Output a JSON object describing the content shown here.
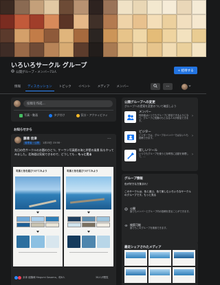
{
  "cover": {
    "colors": [
      "#3b2a22",
      "#8a6a52",
      "#c4a07a",
      "#e2c9a3",
      "#6d4b36",
      "#b89272",
      "#2e2320",
      "#9a7358",
      "#f0e2c6",
      "#e9d7b5",
      "#f3e8cf",
      "#f6ecd8",
      "#ead7b8",
      "#f5ebd6",
      "#7a2c20",
      "#c25a3a",
      "#a03e2a",
      "#d88a5a",
      "#5a3426",
      "#e6b888",
      "#403028",
      "#b37a50",
      "#efd3a8",
      "#e8c18e",
      "#f4deb8",
      "#ecd09e",
      "#f2dfbf",
      "#f6e8cf",
      "#5b3a2c",
      "#d4a06a",
      "#c27c48",
      "#8e5a3a",
      "#e0b57c",
      "#a66a3e",
      "#2b2522",
      "#cc9558",
      "#e7c48a",
      "#f0d8a8",
      "#e4bc78",
      "#efd4a0",
      "#f3e2bf",
      "#e9cc92",
      "#3e2c26",
      "#9a6a48",
      "#6e4a36",
      "#b88458",
      "#d8ac74",
      "#5c3c2c",
      "#221d1b",
      "#a87a52",
      "#deb882",
      "#ecd2a2",
      "#e6c48c",
      "#f1dcb4",
      "#ead09c",
      "#f4e4c4"
    ]
  },
  "group": {
    "name": "いろいろサークル グループ",
    "meta": "公開グループ・メンバー73人",
    "invite_label": "+ 招待する"
  },
  "tabs": [
    "情報",
    "ディスカッション",
    "トピック",
    "イベント",
    "メディア",
    "メンバー"
  ],
  "tab_more_label": "···",
  "composer": {
    "placeholder": "投稿を作成...",
    "actions": [
      {
        "label": "写真・動画",
        "color": "#45bd62"
      },
      {
        "label": "タグ付け",
        "color": "#1877f2"
      },
      {
        "label": "気分・アクティビティ",
        "color": "#f7b928"
      }
    ]
  },
  "notice_label": "お知らせから",
  "post": {
    "author": "藤達 佳津",
    "badge": "管理者・公開",
    "date": "1月15日 15:58 ·",
    "text": "先日の色サークルのお題のひとつ、ケーワン写真館の海と岸壁の風景 私もやってみました。北海道は気候できるので、どうしても...",
    "more_label": "もっと見る",
    "image_caption_left": "写真と色を結びつけてみよう",
    "image_caption_right": "写真と色を結びつけてみよう",
    "reactions_text": "あ体 経験様 Megumi Sasamo、他8人",
    "seen_text": "38人が閲覧"
  },
  "recommend": {
    "title": "公開グループへの変更",
    "subtitle": "グループへの提案を変更のついて確認しよう",
    "items": [
      {
        "title": "メンバー",
        "desc": "利用者はいつでもグループに参加できるようになり、グループに知識のもとなる人々が参加できます。"
      },
      {
        "title": "ビジター",
        "desc": "ビジターでは、グループのメンバーではない人も投稿できます。"
      },
      {
        "title": "新しいツール",
        "desc": "いつでもグループを使うと効率的に活動を管理して、..."
      }
    ],
    "more_label": "もっと見る"
  },
  "info": {
    "title": "グループ情報",
    "p1": "色が好きな方集まれ！",
    "p2": "このサークルは、色と遊ぶ、色で楽しむいろいろなサークルのグループです。もっと見る",
    "rows": [
      {
        "icon": "globe-icon",
        "title": "公開",
        "desc": "誰でもメンバーとグループ内の投稿を見ることができます。"
      },
      {
        "icon": "eye-icon",
        "title": "検索可能",
        "desc": "誰でもこのグループを検索できます。"
      }
    ]
  },
  "media": {
    "title": "最近シェアされたメディア"
  }
}
